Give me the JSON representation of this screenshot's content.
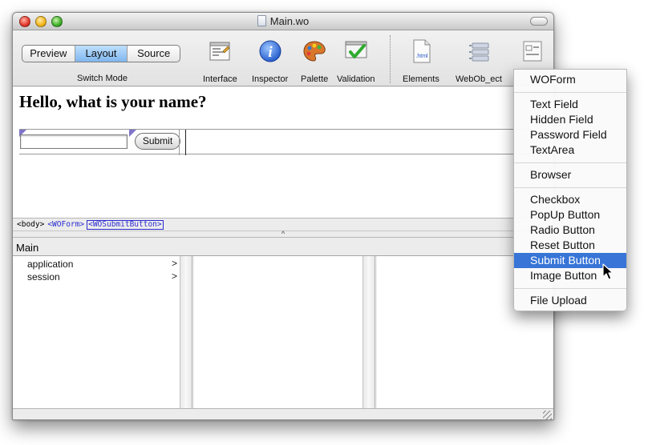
{
  "window": {
    "title": "Main.wo"
  },
  "toolbar": {
    "mode_buttons": [
      "Preview",
      "Layout",
      "Source"
    ],
    "active_mode": "Layout",
    "switch_mode_label": "Switch Mode",
    "tools": [
      {
        "label": "Interface",
        "icon": "interface-icon"
      },
      {
        "label": "Inspector",
        "icon": "info-icon"
      },
      {
        "label": "Palette",
        "icon": "palette-icon"
      },
      {
        "label": "Validation",
        "icon": "validation-icon"
      },
      {
        "label": "Elements",
        "icon": "html-file-icon"
      },
      {
        "label": "WebOb_ect",
        "icon": "webobject-icon"
      }
    ]
  },
  "document": {
    "heading": "Hello, what is your name?",
    "submit_button_label": "Submit"
  },
  "pathbar": {
    "crumbs": [
      "<body>",
      "<WOForm>",
      "<WOSubmitButton>"
    ]
  },
  "browser": {
    "title": "Main",
    "column1": [
      "application",
      "session"
    ]
  },
  "menu": {
    "items": [
      "WOForm",
      "Text Field",
      "Hidden Field",
      "Password Field",
      "TextArea",
      "Browser",
      "Checkbox",
      "PopUp Button",
      "Radio Button",
      "Reset Button",
      "Submit Button",
      "Image Button",
      "File Upload"
    ],
    "selected": "Submit Button"
  },
  "colors": {
    "selection": "#3875d7",
    "active_segment": "#7fb6ee",
    "link": "#2a2ad2"
  }
}
